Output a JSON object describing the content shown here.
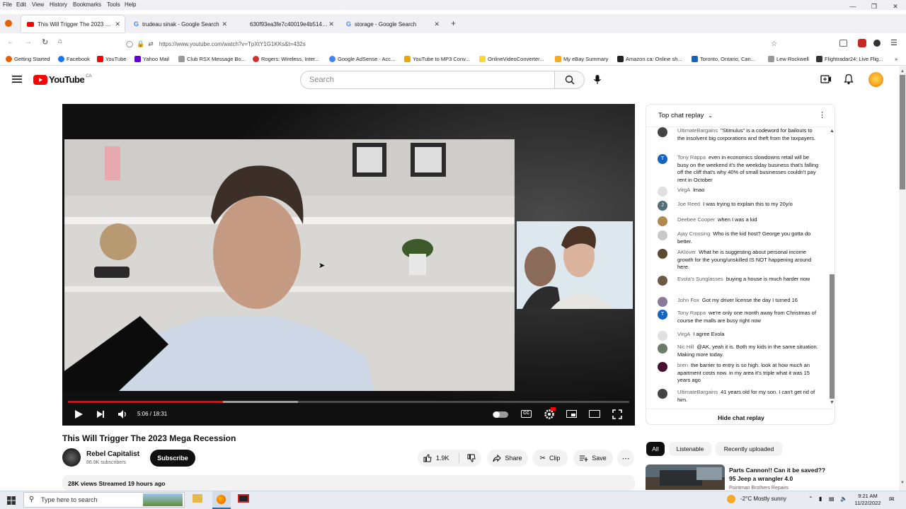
{
  "menu": [
    "File",
    "Edit",
    "View",
    "History",
    "Bookmarks",
    "Tools",
    "Help"
  ],
  "tabs": [
    {
      "title": "This Will Trigger The 2023 Mega",
      "active": true,
      "icon": "youtube-icon"
    },
    {
      "title": "trudeau sinak - Google Search",
      "active": false,
      "icon": "google-icon"
    },
    {
      "title": "630f93ea3fe7c40019e4b514 (W...",
      "active": false,
      "icon": "page-icon"
    },
    {
      "title": "storage - Google Search",
      "active": false,
      "icon": "google-icon"
    }
  ],
  "url": "https://www.youtube.com/watch?v=TpXtY1G1KKs&t=432s",
  "bookmarks": [
    "Getting Started",
    "Facebook",
    "YouTube",
    "Yahoo Mail",
    "Club RSX Message Bo...",
    "Rogers: Wireless, Inter...",
    "Google AdSense - Acc...",
    "YouTube to MP3 Conv...",
    "OnlineVideoConverter...",
    "My eBay Summary",
    "Amazon.ca: Online sh...",
    "Toronto, Ontario, Can...",
    "Lew Rockwell",
    "Flightradar24: Live Flig..."
  ],
  "yt": {
    "logo_text": "YouTube",
    "region": "CA",
    "search_placeholder": "Search"
  },
  "player": {
    "time": "5:06 / 18:31",
    "progress_fraction": 0.276,
    "buffered_fraction": 0.41
  },
  "video": {
    "title": "This Will Trigger The 2023 Mega Recession",
    "channel": "Rebel Capitalist",
    "subscribers": "86.9K subscribers",
    "subscribe_label": "Subscribe",
    "likes": "1.9K",
    "share_label": "Share",
    "clip_label": "Clip",
    "save_label": "Save",
    "views_line": "28K views  Streamed 19 hours ago"
  },
  "chat": {
    "header": "Top chat replay",
    "hide_label": "Hide chat replay",
    "messages": [
      {
        "author": "UltimateBargains",
        "text": "\"Stimulus\" is a codeword for bailouts to the insolvent big corporations and theft from the taxpayers.",
        "avatar": "",
        "color": "#444444"
      },
      {
        "author": "Tony Rappa",
        "text": "even in economics slowdowns retail will be busy on the weekend it's the weekday business that's falling off the cliff that's why 40% of small businesses couldn't pay rent in October",
        "avatar": "T",
        "color": "#1565c0"
      },
      {
        "author": "VirgA",
        "text": "lmao",
        "avatar": "",
        "color": "#e0e0e0"
      },
      {
        "author": "Joe Reed",
        "text": "I was trying to explain this to my 20y/o",
        "avatar": "J",
        "color": "#546e7a"
      },
      {
        "author": "Deebee Cooper",
        "text": "when I was a kid",
        "avatar": "",
        "color": "#b08850"
      },
      {
        "author": "Ajay Crossing",
        "text": "Who is the kid host? George you gotta do better.",
        "avatar": "",
        "color": "#c8c8c8"
      },
      {
        "author": "AKlover",
        "text": "What he is suggesting about personal income growth for the young/unskilled IS NOT happening around here.",
        "avatar": "",
        "color": "#5a4a30"
      },
      {
        "author": "Evola's Sunglasses",
        "text": "buying a house is much harder now",
        "avatar": "",
        "color": "#6d5a44"
      },
      {
        "author": "John Fox",
        "text": "Got my driver license the day I turned 16",
        "avatar": "",
        "color": "#8a7a9a"
      },
      {
        "author": "Tony Rappa",
        "text": "we're only one month away from Christmas of course the malls are busy right now",
        "avatar": "T",
        "color": "#1565c0"
      },
      {
        "author": "VirgA",
        "text": "I agree Evola",
        "avatar": "",
        "color": "#e0e0e0"
      },
      {
        "author": "Nic Hill",
        "text": "@AK, yeah it is. Both my kids in the same situation. Making more today.",
        "avatar": "",
        "color": "#6b7b6b"
      },
      {
        "author": "bren",
        "text": "the barrier to entry is so high. look at how much an apartment costs now. in my area it's triple what it was 15 years ago",
        "avatar": "",
        "color": "#4a1030"
      },
      {
        "author": "UltimateBargains",
        "text": "41 years old for my son. I can't get rid of him.",
        "avatar": "",
        "color": "#444444"
      }
    ]
  },
  "chips": [
    "All",
    "Listenable",
    "Recently uploaded"
  ],
  "recommended": {
    "title": "Parts Cannon!! Can it be saved?? 95 Jeep a wrangler 4.0",
    "channel": "Pointman Brothers Repairs"
  },
  "taskbar": {
    "search_placeholder": "Type here to search",
    "weather": "-2°C  Mostly sunny",
    "time": "9:21 AM",
    "date": "11/22/2022"
  }
}
